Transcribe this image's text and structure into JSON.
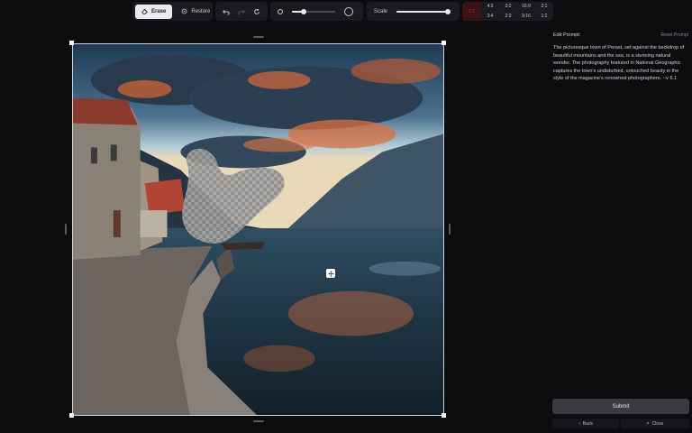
{
  "toolbar": {
    "erase_label": "Erase",
    "restore_label": "Restore",
    "brush_size_fraction": 0.28,
    "scale_label": "Scale",
    "scale_fraction": 0.98,
    "ratios": [
      "4:3",
      "3:2",
      "16:9",
      "2:1",
      "3:4",
      "2:3",
      "9:16",
      "1:2"
    ],
    "active_ratio": "1:1"
  },
  "panel": {
    "edit_prompt_label": "Edit Prompt:",
    "reset_prompt_label": "Reset Prompt",
    "prompt_text": "The picturesque town of Perast, set against the backdrop of beautiful mountains and the sea, is a stunning natural wonder. The photography featured in National Geographic captures the town's undisturbed, untouched beauty in the style of the magazine's renowned photographers. --v 6.1",
    "submit_label": "Submit",
    "back_label": "Back",
    "close_label": "Close"
  },
  "icons": {
    "erase": "eraser-icon",
    "restore": "restore-icon",
    "undo": "undo-icon",
    "redo": "redo-icon",
    "reset": "reset-icon",
    "move": "move-icon"
  },
  "colors": {
    "accent_ratio_bg": "#3a1414",
    "accent_ratio_text": "#9e3030",
    "toolbar_bg": "#1a1b1e",
    "page_bg": "#0b0c0e"
  }
}
